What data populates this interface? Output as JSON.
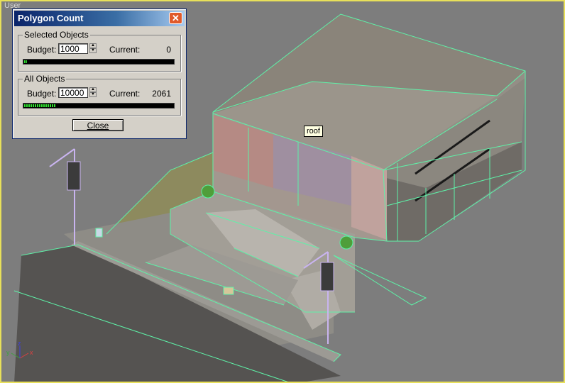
{
  "viewport": {
    "label": "User"
  },
  "tooltip": "roof",
  "dialog": {
    "title": "Polygon Count",
    "selected": {
      "group_label": "Selected Objects",
      "budget_label": "Budget:",
      "budget_value": "1000",
      "current_label": "Current:",
      "current_value": "0",
      "fill_fraction": 0.02
    },
    "all": {
      "group_label": "All Objects",
      "budget_label": "Budget:",
      "budget_value": "10000",
      "current_label": "Current:",
      "current_value": "2061",
      "fill_fraction": 0.21
    },
    "close_label": "Close"
  },
  "axis_gizmo": {
    "x": "x",
    "y": "y",
    "z": "z"
  },
  "colors": {
    "wire": "#5ef2a8",
    "viewport_bg": "#7d7d7d",
    "active_border": "#e8e05a"
  }
}
